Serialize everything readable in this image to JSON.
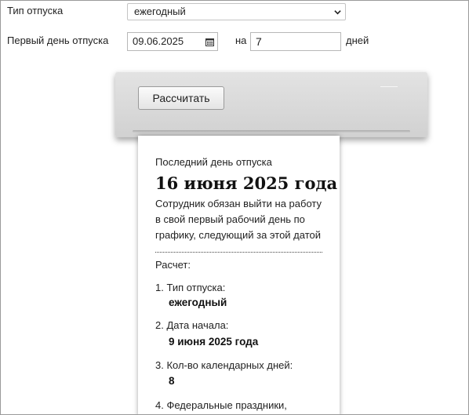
{
  "form": {
    "vacation_type_label": "Тип отпуска",
    "vacation_type_value": "ежегодный",
    "first_day_label": "Первый день отпуска",
    "first_day_value": "09.06.2025",
    "na_label": "на",
    "days_value": "7",
    "days_label": "дней"
  },
  "calculate_button": "Рассчитать",
  "result": {
    "last_day_caption": "Последний день отпуска",
    "last_day_value": "16 июня 2025 года",
    "note": "Сотрудник обязан выйти на работу в свой первый рабочий день по графику, следующий за этой датой",
    "calc_heading": "Расчет:",
    "items": [
      {
        "label": "1. Тип отпуска:",
        "value": "ежегодный"
      },
      {
        "label": "2. Дата начала:",
        "value": "9 июня 2025 года"
      },
      {
        "label": "3. Кол-во календарных дней:",
        "value": "8"
      },
      {
        "label": "4. Федеральные праздники,",
        "value": ""
      }
    ]
  },
  "icons": {
    "select_chevron": "chevron-down-icon",
    "date_picker": "calendar-icon"
  }
}
